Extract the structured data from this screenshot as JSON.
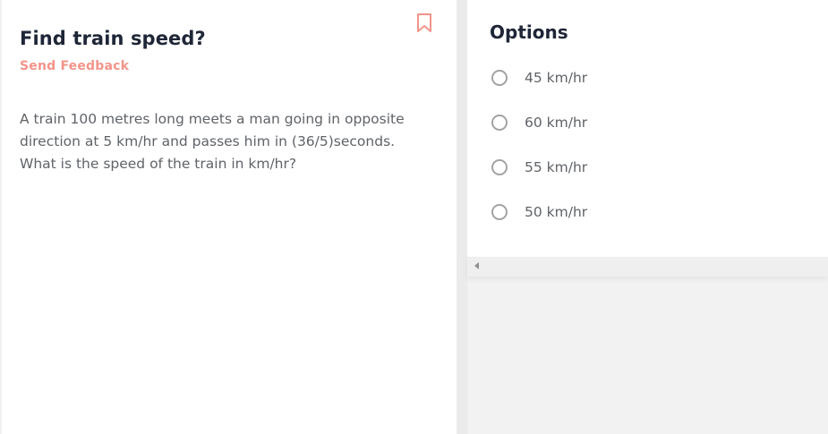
{
  "question": {
    "title": "Find train speed?",
    "feedback_label": "Send Feedback",
    "text": "A train 100 metres long meets a man going in opposite direction at 5 km/hr and passes him in (36/5)seconds. What is the speed of the train in km/hr?"
  },
  "options": {
    "title": "Options",
    "items": [
      {
        "label": "45 km/hr"
      },
      {
        "label": "60 km/hr"
      },
      {
        "label": "55 km/hr"
      },
      {
        "label": "50 km/hr"
      }
    ]
  },
  "icons": {
    "bookmark": "bookmark-icon",
    "scroll_left": "scroll-left-arrow-icon"
  },
  "colors": {
    "accent": "#f4948a",
    "title": "#1e2637",
    "body_text": "#5f6368"
  }
}
